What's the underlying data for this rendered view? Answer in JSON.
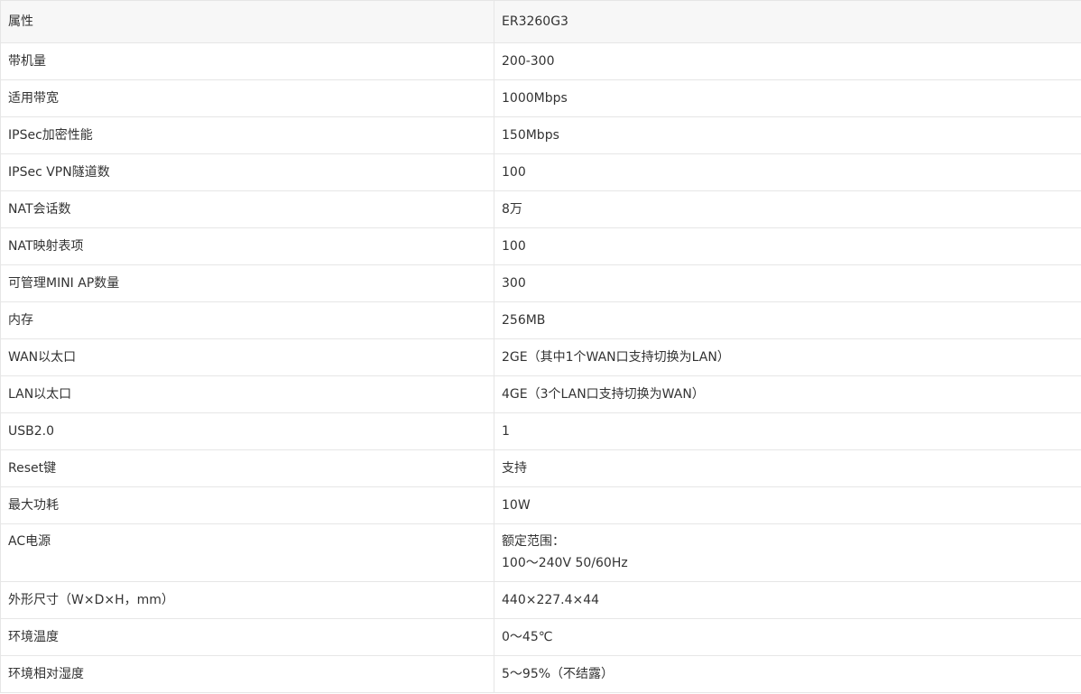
{
  "table": {
    "header": {
      "label": "属性",
      "value": "ER3260G3"
    },
    "rows": [
      {
        "label": "带机量",
        "value": "200-300"
      },
      {
        "label": "适用带宽",
        "value": "1000Mbps"
      },
      {
        "label": "IPSec加密性能",
        "value": "150Mbps"
      },
      {
        "label": "IPSec VPN隧道数",
        "value": "100"
      },
      {
        "label": "NAT会话数",
        "value": "8万"
      },
      {
        "label": "NAT映射表项",
        "value": "100"
      },
      {
        "label": "可管理MINI AP数量",
        "value": "300"
      },
      {
        "label": "内存",
        "value": "256MB"
      },
      {
        "label": "WAN以太口",
        "value": "2GE（其中1个WAN口支持切换为LAN）"
      },
      {
        "label": "LAN以太口",
        "value": "4GE（3个LAN口支持切换为WAN）"
      },
      {
        "label": "USB2.0",
        "value": "1"
      },
      {
        "label": "Reset键",
        "value": "支持"
      },
      {
        "label": "最大功耗",
        "value": "10W"
      },
      {
        "label": "AC电源",
        "value_line1": "额定范围：",
        "value_line2": "100～240V 50/60Hz"
      },
      {
        "label": "外形尺寸（W×D×H，mm）",
        "value": "440×227.4×44"
      },
      {
        "label": "环境温度",
        "value": "0～45℃"
      },
      {
        "label": "环境相对湿度",
        "value": "5～95%（不结露）"
      }
    ]
  }
}
